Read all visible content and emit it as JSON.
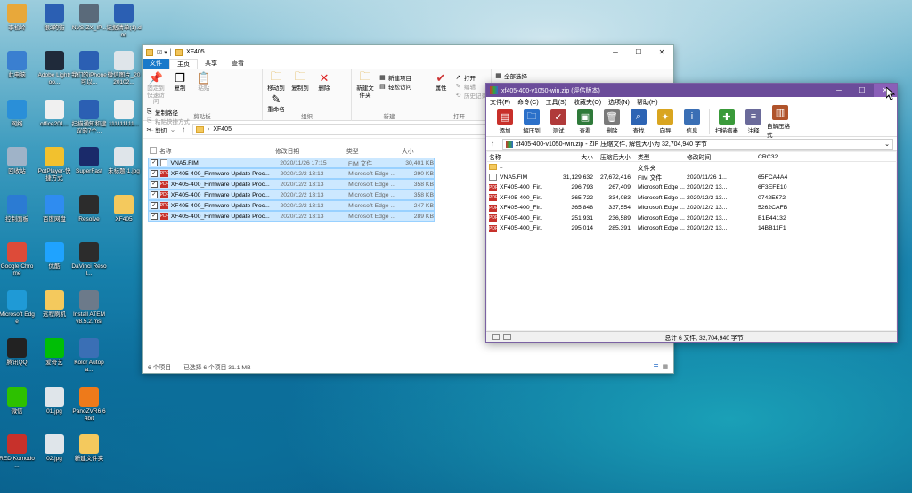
{
  "desktop": {
    "icons": [
      {
        "label": "李松岭",
        "icon": "user-folder-icon"
      },
      {
        "label": "很2的街",
        "icon": "word-doc-icon"
      },
      {
        "label": "NVS-ZX_IP...",
        "icon": "search-magnifier-icon"
      },
      {
        "label": "证据清单(1).doc",
        "icon": "word-doc-icon"
      },
      {
        "label": "此电脑",
        "icon": "computer-icon"
      },
      {
        "label": "Adobe Lightroo...",
        "icon": "lightroom-icon"
      },
      {
        "label": "我们的iPhone可以...",
        "icon": "word-doc-icon"
      },
      {
        "label": "微信图片_2020102...",
        "icon": "image-file-icon"
      },
      {
        "label": "网络",
        "icon": "network-icon"
      },
      {
        "label": "office201...",
        "icon": "doc-file-icon"
      },
      {
        "label": "扫描通知和建议的7个...",
        "icon": "word-doc-icon"
      },
      {
        "label": "111111111...",
        "icon": "doc-file-icon"
      },
      {
        "label": "回收站",
        "icon": "recycle-bin-icon"
      },
      {
        "label": "PotPlayer-快捷方式",
        "icon": "potplayer-icon"
      },
      {
        "label": "SuperFast",
        "icon": "superfast-icon"
      },
      {
        "label": "未标题-1.jpg",
        "icon": "image-file-icon"
      },
      {
        "label": "控制面板",
        "icon": "control-panel-icon"
      },
      {
        "label": "百度网盘",
        "icon": "baidu-netdisk-icon"
      },
      {
        "label": "Resolve",
        "icon": "davinci-resolve-icon"
      },
      {
        "label": "XF405",
        "icon": "folder-icon"
      },
      {
        "label": "Google Chrome",
        "icon": "chrome-icon"
      },
      {
        "label": "优酷",
        "icon": "youku-icon"
      },
      {
        "label": "DaVinci Resol...",
        "icon": "davinci-resolve-icon"
      },
      {
        "label": "Microsoft Edge",
        "icon": "edge-icon"
      },
      {
        "label": "远程刷机",
        "icon": "folder-icon"
      },
      {
        "label": "Install ATEM v8.5.2.msi",
        "icon": "installer-icon"
      },
      {
        "label": "腾讯QQ",
        "icon": "qq-icon"
      },
      {
        "label": "爱奇艺",
        "icon": "iqiyi-icon"
      },
      {
        "label": "Kolor Autopa...",
        "icon": "kolor-autopano-icon"
      },
      {
        "label": "微信",
        "icon": "wechat-icon"
      },
      {
        "label": "01.jpg",
        "icon": "image-file-icon"
      },
      {
        "label": "PanoZVR6 64bit",
        "icon": "pano2vr-icon"
      },
      {
        "label": "RED Komodo ...",
        "icon": "pdf-file-icon"
      },
      {
        "label": "02.jpg",
        "icon": "image-file-icon"
      },
      {
        "label": "新建文件夹",
        "icon": "folder-icon"
      }
    ]
  },
  "explorer": {
    "title": "XF405",
    "tabs": [
      "文件",
      "主页",
      "共享",
      "查看"
    ],
    "ribbon": {
      "clipboard": {
        "pin": "固定到快速访问",
        "copy": "复制",
        "paste": "粘贴",
        "copy_path": "复制路径",
        "paste_shortcut": "粘贴快捷方式",
        "cut": "剪切",
        "group": "剪贴板"
      },
      "organize": {
        "move": "移动到",
        "copyto": "复制到",
        "delete": "删除",
        "rename": "重命名",
        "group": "组织"
      },
      "new": {
        "folder": "新建文件夹",
        "item": "新建项目",
        "easy": "轻松访问",
        "group": "新建"
      },
      "open": {
        "props": "属性",
        "open": "打开",
        "edit": "编辑",
        "history": "历史记录",
        "group": "打开"
      },
      "select": {
        "all": "全部选择"
      }
    },
    "path": "XF405",
    "columns": [
      "名称",
      "修改日期",
      "类型",
      "大小"
    ],
    "files": [
      {
        "name": "VNA5.FIM",
        "date": "2020/11/26 17:15",
        "type": "FIM 文件",
        "size": "30,401 KB",
        "kind": "fim"
      },
      {
        "name": "XF405-400_Firmware Update Proc...",
        "date": "2020/12/2 13:13",
        "type": "Microsoft Edge ...",
        "size": "290 KB",
        "kind": "pdf"
      },
      {
        "name": "XF405-400_Firmware Update Proc...",
        "date": "2020/12/2 13:13",
        "type": "Microsoft Edge ...",
        "size": "358 KB",
        "kind": "pdf"
      },
      {
        "name": "XF405-400_Firmware Update Proc...",
        "date": "2020/12/2 13:13",
        "type": "Microsoft Edge ...",
        "size": "358 KB",
        "kind": "pdf"
      },
      {
        "name": "XF405-400_Firmware Update Proc...",
        "date": "2020/12/2 13:13",
        "type": "Microsoft Edge ...",
        "size": "247 KB",
        "kind": "pdf"
      },
      {
        "name": "XF405-400_Firmware Update Proc...",
        "date": "2020/12/2 13:13",
        "type": "Microsoft Edge ...",
        "size": "289 KB",
        "kind": "pdf"
      }
    ],
    "status": {
      "count": "6 个项目",
      "selected": "已选择 6 个项目 31.1 MB"
    }
  },
  "winrar": {
    "title": "xf405-400-v1050-win.zip (评估版本)",
    "menu": [
      "文件(F)",
      "命令(C)",
      "工具(S)",
      "收藏夹(O)",
      "选项(N)",
      "帮助(H)"
    ],
    "tools": [
      {
        "label": "添加",
        "icon": "add-archive-icon",
        "color": "#c8302a"
      },
      {
        "label": "解压到",
        "icon": "extract-folder-icon",
        "color": "#2b70c9"
      },
      {
        "label": "测试",
        "icon": "test-icon",
        "color": "#b03a3a"
      },
      {
        "label": "查看",
        "icon": "view-book-icon",
        "color": "#2f7a3a"
      },
      {
        "label": "删除",
        "icon": "trash-icon",
        "color": "#7a7a7a"
      },
      {
        "label": "查找",
        "icon": "find-magnifier-icon",
        "color": "#2d64b4"
      },
      {
        "label": "向导",
        "icon": "wizard-wand-icon",
        "color": "#d9a520"
      },
      {
        "label": "信息",
        "icon": "info-icon",
        "color": "#3a6fb5"
      },
      {
        "label": "扫描病毒",
        "icon": "virus-scan-icon",
        "color": "#3a9a3a"
      },
      {
        "label": "注释",
        "icon": "comment-icon",
        "color": "#6a6a9a"
      },
      {
        "label": "自解压格式",
        "icon": "sfx-books-icon",
        "color": "#b0532a"
      }
    ],
    "path": "xf405-400-v1050-win.zip - ZIP 压缩文件, 解包大小为 32,704,940 字节",
    "columns": [
      "名称",
      "大小",
      "压缩后大小",
      "类型",
      "修改时间",
      "CRC32"
    ],
    "rows": [
      {
        "name": "..",
        "size": "",
        "packed": "",
        "type": "文件夹",
        "date": "",
        "crc": "",
        "kind": "folder"
      },
      {
        "name": "VNA5.FIM",
        "size": "31,129,632",
        "packed": "27,672,416",
        "type": "FIM 文件",
        "date": "2020/11/26 1...",
        "crc": "65FCA4A4",
        "kind": "fim"
      },
      {
        "name": "XF405-400_Fir...",
        "size": "296,793",
        "packed": "267,409",
        "type": "Microsoft Edge ...",
        "date": "2020/12/2 13...",
        "crc": "6F3EFE10",
        "kind": "pdf"
      },
      {
        "name": "XF405-400_Fir...",
        "size": "365,722",
        "packed": "334,083",
        "type": "Microsoft Edge ...",
        "date": "2020/12/2 13...",
        "crc": "0742E672",
        "kind": "pdf"
      },
      {
        "name": "XF405-400_Fir...",
        "size": "365,848",
        "packed": "337,554",
        "type": "Microsoft Edge ...",
        "date": "2020/12/2 13...",
        "crc": "5262CAFB",
        "kind": "pdf"
      },
      {
        "name": "XF405-400_Fir...",
        "size": "251,931",
        "packed": "236,589",
        "type": "Microsoft Edge ...",
        "date": "2020/12/2 13...",
        "crc": "B1E44132",
        "kind": "pdf"
      },
      {
        "name": "XF405-400_Fir...",
        "size": "295,014",
        "packed": "285,391",
        "type": "Microsoft Edge ...",
        "date": "2020/12/2 13...",
        "crc": "14BB11F1",
        "kind": "pdf"
      }
    ],
    "status": "总计 6 文件, 32,704,940 字节"
  }
}
